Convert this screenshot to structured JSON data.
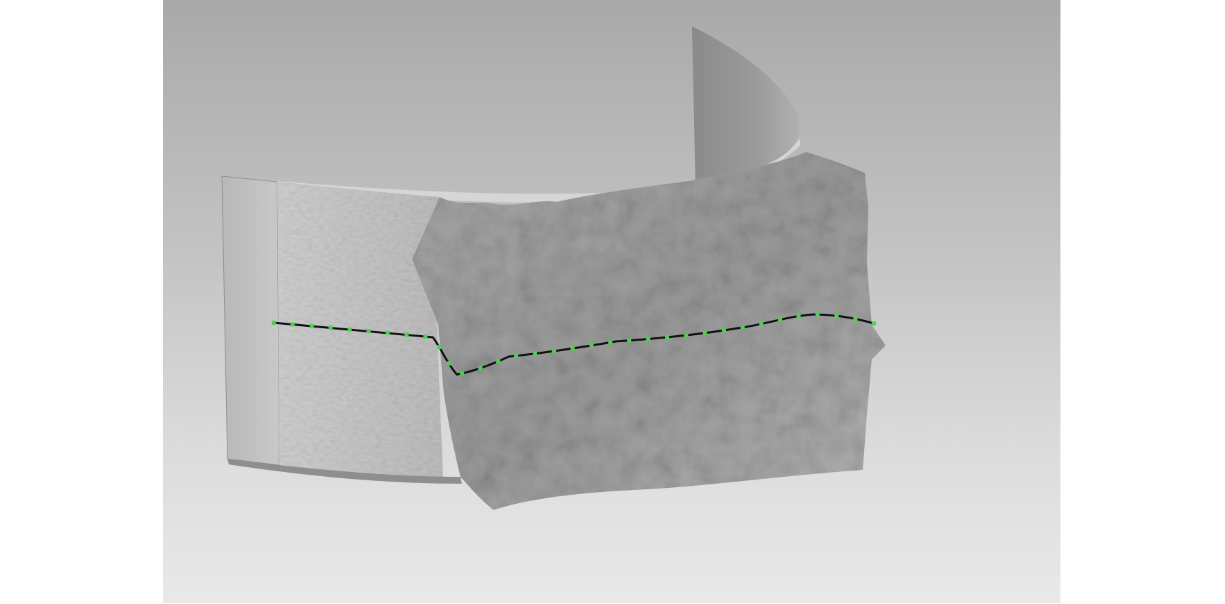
{
  "viewport": {
    "background_top": "#a9a9a9",
    "background_bottom": "#e9e9e9"
  },
  "model": {
    "description_icon": "3d-scanned-curved-surface",
    "surface_color": "#9c9c9c",
    "smooth_color": "#b9b9b9",
    "section_curve_color": "#111111",
    "control_point_color": "#4ed04e",
    "control_point_count": 34
  }
}
